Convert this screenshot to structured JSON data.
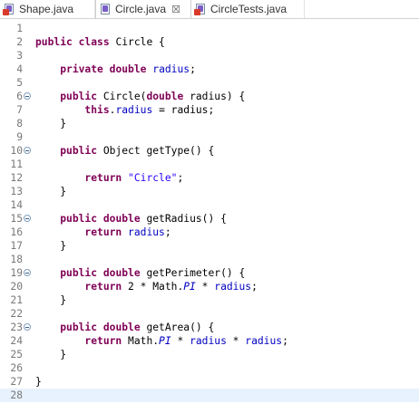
{
  "tabs": [
    {
      "label": "Shape.java",
      "active": false,
      "has_close": false
    },
    {
      "label": "Circle.java",
      "active": true,
      "has_close": true
    },
    {
      "label": "CircleTests.java",
      "active": false,
      "has_close": false
    }
  ],
  "close_glyph": "☒",
  "current_line": 28,
  "colors": {
    "keyword": "#7f0055",
    "field": "#0000c0",
    "string": "#2a00ff",
    "line_number": "#787878",
    "current_line_bg": "#e8f2fe"
  },
  "lines": [
    {
      "n": "1",
      "fold": false,
      "tokens": []
    },
    {
      "n": "2",
      "fold": false,
      "tokens": [
        [
          "kw",
          "public"
        ],
        [
          "t",
          " "
        ],
        [
          "kw",
          "class"
        ],
        [
          "t",
          " Circle {"
        ]
      ]
    },
    {
      "n": "3",
      "fold": false,
      "tokens": []
    },
    {
      "n": "4",
      "fold": false,
      "tokens": [
        [
          "t",
          "    "
        ],
        [
          "kw",
          "private"
        ],
        [
          "t",
          " "
        ],
        [
          "kw",
          "double"
        ],
        [
          "t",
          " "
        ],
        [
          "fld",
          "radius"
        ],
        [
          "t",
          ";"
        ]
      ]
    },
    {
      "n": "5",
      "fold": false,
      "tokens": []
    },
    {
      "n": "6",
      "fold": true,
      "tokens": [
        [
          "t",
          "    "
        ],
        [
          "kw",
          "public"
        ],
        [
          "t",
          " Circle("
        ],
        [
          "kw",
          "double"
        ],
        [
          "t",
          " radius) {"
        ]
      ]
    },
    {
      "n": "7",
      "fold": false,
      "tokens": [
        [
          "t",
          "        "
        ],
        [
          "kw",
          "this"
        ],
        [
          "t",
          "."
        ],
        [
          "fld",
          "radius"
        ],
        [
          "t",
          " = radius;"
        ]
      ]
    },
    {
      "n": "8",
      "fold": false,
      "tokens": [
        [
          "t",
          "    }"
        ]
      ]
    },
    {
      "n": "9",
      "fold": false,
      "tokens": []
    },
    {
      "n": "10",
      "fold": true,
      "tokens": [
        [
          "t",
          "    "
        ],
        [
          "kw",
          "public"
        ],
        [
          "t",
          " Object getType() {"
        ]
      ]
    },
    {
      "n": "11",
      "fold": false,
      "tokens": []
    },
    {
      "n": "12",
      "fold": false,
      "tokens": [
        [
          "t",
          "        "
        ],
        [
          "kw",
          "return"
        ],
        [
          "t",
          " "
        ],
        [
          "str",
          "\"Circle\""
        ],
        [
          "t",
          ";"
        ]
      ]
    },
    {
      "n": "13",
      "fold": false,
      "tokens": [
        [
          "t",
          "    }"
        ]
      ]
    },
    {
      "n": "14",
      "fold": false,
      "tokens": []
    },
    {
      "n": "15",
      "fold": true,
      "tokens": [
        [
          "t",
          "    "
        ],
        [
          "kw",
          "public"
        ],
        [
          "t",
          " "
        ],
        [
          "kw",
          "double"
        ],
        [
          "t",
          " getRadius() {"
        ]
      ]
    },
    {
      "n": "16",
      "fold": false,
      "tokens": [
        [
          "t",
          "        "
        ],
        [
          "kw",
          "return"
        ],
        [
          "t",
          " "
        ],
        [
          "fld",
          "radius"
        ],
        [
          "t",
          ";"
        ]
      ]
    },
    {
      "n": "17",
      "fold": false,
      "tokens": [
        [
          "t",
          "    }"
        ]
      ]
    },
    {
      "n": "18",
      "fold": false,
      "tokens": []
    },
    {
      "n": "19",
      "fold": true,
      "tokens": [
        [
          "t",
          "    "
        ],
        [
          "kw",
          "public"
        ],
        [
          "t",
          " "
        ],
        [
          "kw",
          "double"
        ],
        [
          "t",
          " getPerimeter() {"
        ]
      ]
    },
    {
      "n": "20",
      "fold": false,
      "tokens": [
        [
          "t",
          "        "
        ],
        [
          "kw",
          "return"
        ],
        [
          "t",
          " 2 * Math."
        ],
        [
          "sfield",
          "PI"
        ],
        [
          "t",
          " * "
        ],
        [
          "fld",
          "radius"
        ],
        [
          "t",
          ";"
        ]
      ]
    },
    {
      "n": "21",
      "fold": false,
      "tokens": [
        [
          "t",
          "    }"
        ]
      ]
    },
    {
      "n": "22",
      "fold": false,
      "tokens": []
    },
    {
      "n": "23",
      "fold": true,
      "tokens": [
        [
          "t",
          "    "
        ],
        [
          "kw",
          "public"
        ],
        [
          "t",
          " "
        ],
        [
          "kw",
          "double"
        ],
        [
          "t",
          " getArea() {"
        ]
      ]
    },
    {
      "n": "24",
      "fold": false,
      "tokens": [
        [
          "t",
          "        "
        ],
        [
          "kw",
          "return"
        ],
        [
          "t",
          " Math."
        ],
        [
          "sfield",
          "PI"
        ],
        [
          "t",
          " * "
        ],
        [
          "fld",
          "radius"
        ],
        [
          "t",
          " * "
        ],
        [
          "fld",
          "radius"
        ],
        [
          "t",
          ";"
        ]
      ]
    },
    {
      "n": "25",
      "fold": false,
      "tokens": [
        [
          "t",
          "    }"
        ]
      ]
    },
    {
      "n": "26",
      "fold": false,
      "tokens": []
    },
    {
      "n": "27",
      "fold": false,
      "tokens": [
        [
          "t",
          "}"
        ]
      ]
    },
    {
      "n": "28",
      "fold": false,
      "tokens": []
    }
  ]
}
